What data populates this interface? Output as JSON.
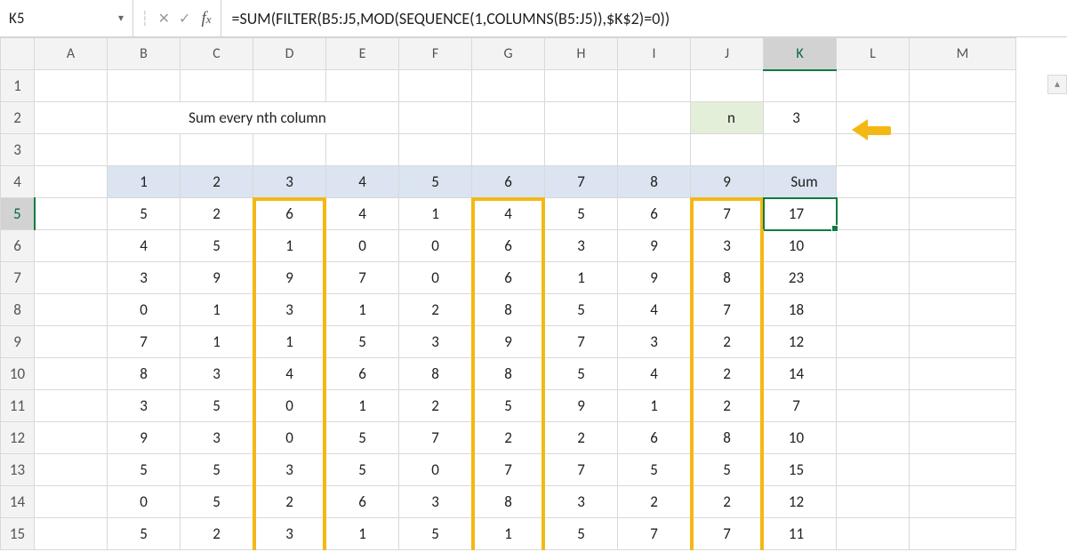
{
  "namebox": "K5",
  "formula": "=SUM(FILTER(B5:J5,MOD(SEQUENCE(1,COLUMNS(B5:J5)),$K$2)=0))",
  "columns": [
    "A",
    "B",
    "C",
    "D",
    "E",
    "F",
    "G",
    "H",
    "I",
    "J",
    "K",
    "L",
    "M"
  ],
  "rows": [
    "1",
    "2",
    "3",
    "4",
    "5",
    "6",
    "7",
    "8",
    "9",
    "10",
    "11",
    "12",
    "13",
    "14",
    "15"
  ],
  "title": "Sum every nth column",
  "n_label": "n",
  "n_value": 3,
  "header4": {
    "nums": [
      1,
      2,
      3,
      4,
      5,
      6,
      7,
      8,
      9
    ],
    "sum_label": "Sum"
  },
  "data": [
    {
      "vals": [
        5,
        2,
        6,
        4,
        1,
        4,
        5,
        6,
        7
      ],
      "sum": 17
    },
    {
      "vals": [
        4,
        5,
        1,
        0,
        0,
        6,
        3,
        9,
        3
      ],
      "sum": 10
    },
    {
      "vals": [
        3,
        9,
        9,
        7,
        0,
        6,
        1,
        9,
        8
      ],
      "sum": 23
    },
    {
      "vals": [
        0,
        1,
        3,
        1,
        2,
        8,
        5,
        4,
        7
      ],
      "sum": 18
    },
    {
      "vals": [
        7,
        1,
        1,
        5,
        3,
        9,
        7,
        3,
        2
      ],
      "sum": 12
    },
    {
      "vals": [
        8,
        3,
        4,
        6,
        8,
        8,
        5,
        4,
        2
      ],
      "sum": 14
    },
    {
      "vals": [
        3,
        5,
        0,
        1,
        2,
        5,
        9,
        1,
        2
      ],
      "sum": 7
    },
    {
      "vals": [
        9,
        3,
        0,
        5,
        7,
        2,
        2,
        6,
        8
      ],
      "sum": 10
    },
    {
      "vals": [
        5,
        5,
        3,
        5,
        0,
        7,
        7,
        5,
        5
      ],
      "sum": 15
    },
    {
      "vals": [
        0,
        5,
        2,
        6,
        3,
        8,
        3,
        2,
        2
      ],
      "sum": 12
    },
    {
      "vals": [
        5,
        2,
        3,
        1,
        5,
        1,
        5,
        7,
        7
      ],
      "sum": 11
    }
  ],
  "highlight_cols": [
    2,
    5,
    8
  ],
  "selected_cell": "K5",
  "chart_data": {
    "type": "table",
    "title": "Sum every nth column",
    "n": 3,
    "column_index": [
      1,
      2,
      3,
      4,
      5,
      6,
      7,
      8,
      9
    ],
    "rows": [
      {
        "values": [
          5,
          2,
          6,
          4,
          1,
          4,
          5,
          6,
          7
        ],
        "sum": 17
      },
      {
        "values": [
          4,
          5,
          1,
          0,
          0,
          6,
          3,
          9,
          3
        ],
        "sum": 10
      },
      {
        "values": [
          3,
          9,
          9,
          7,
          0,
          6,
          1,
          9,
          8
        ],
        "sum": 23
      },
      {
        "values": [
          0,
          1,
          3,
          1,
          2,
          8,
          5,
          4,
          7
        ],
        "sum": 18
      },
      {
        "values": [
          7,
          1,
          1,
          5,
          3,
          9,
          7,
          3,
          2
        ],
        "sum": 12
      },
      {
        "values": [
          8,
          3,
          4,
          6,
          8,
          8,
          5,
          4,
          2
        ],
        "sum": 14
      },
      {
        "values": [
          3,
          5,
          0,
          1,
          2,
          5,
          9,
          1,
          2
        ],
        "sum": 7
      },
      {
        "values": [
          9,
          3,
          0,
          5,
          7,
          2,
          2,
          6,
          8
        ],
        "sum": 10
      },
      {
        "values": [
          5,
          5,
          3,
          5,
          0,
          7,
          7,
          5,
          5
        ],
        "sum": 15
      },
      {
        "values": [
          0,
          5,
          2,
          6,
          3,
          8,
          3,
          2,
          2
        ],
        "sum": 12
      },
      {
        "values": [
          5,
          2,
          3,
          1,
          5,
          1,
          5,
          7,
          7
        ],
        "sum": 11
      }
    ],
    "highlighted_columns": [
      3,
      6,
      9
    ]
  }
}
